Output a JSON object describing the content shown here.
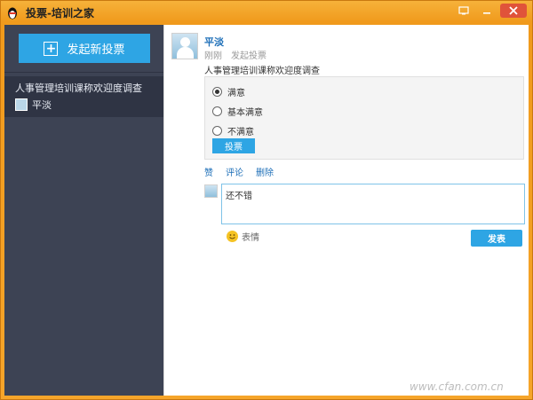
{
  "window": {
    "title": "投票-培训之家"
  },
  "sidebar": {
    "new_vote_label": "发起新投票",
    "items": [
      {
        "title": "人事管理培训课称欢迎度调查",
        "user": "平淡"
      }
    ]
  },
  "post": {
    "author": "平淡",
    "time": "刚刚",
    "action": "发起投票",
    "question": "人事管理培训课称欢迎度调查",
    "options": [
      {
        "label": "满意",
        "selected": true
      },
      {
        "label": "基本满意",
        "selected": false
      },
      {
        "label": "不满意",
        "selected": false
      }
    ],
    "vote_button": "投票",
    "actions": {
      "like": "赞",
      "comment": "评论",
      "delete": "删除"
    }
  },
  "comment": {
    "value": "还不错",
    "emoji_label": "表情",
    "send_label": "发表"
  },
  "watermark": "www.cfan.com.cn",
  "colors": {
    "titlebar": "#f09a1c",
    "sidebar": "#3d4354",
    "accent": "#2ea5e4",
    "link": "#1e6fb8"
  }
}
